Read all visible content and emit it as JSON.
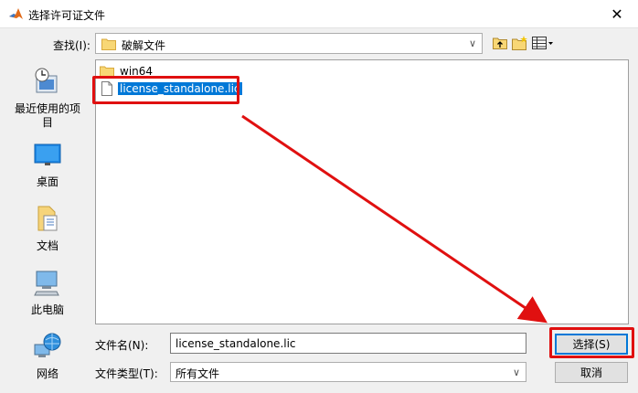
{
  "window": {
    "title": "选择许可证文件",
    "close_glyph": "✕",
    "app_icon": "matlab-icon"
  },
  "lookin": {
    "label": "查找(I):",
    "value": "破解文件"
  },
  "toolbar": {
    "icons": [
      "up-folder-icon",
      "new-folder-icon",
      "view-menu-icon"
    ]
  },
  "places": [
    {
      "label": "最近使用的项目",
      "icon": "recent-icon"
    },
    {
      "label": "桌面",
      "icon": "desktop-icon"
    },
    {
      "label": "文档",
      "icon": "documents-icon"
    },
    {
      "label": "此电脑",
      "icon": "computer-icon"
    },
    {
      "label": "网络",
      "icon": "network-icon"
    }
  ],
  "files": [
    {
      "name": "win64",
      "type": "folder",
      "selected": false
    },
    {
      "name": "license_standalone.lic",
      "type": "file",
      "selected": true
    }
  ],
  "filename": {
    "label": "文件名(N):",
    "value": "license_standalone.lic"
  },
  "filetype": {
    "label": "文件类型(T):",
    "value": "所有文件"
  },
  "buttons": {
    "select": "选择(S)",
    "cancel": "取消"
  },
  "colors": {
    "annotation": "#e01010",
    "selection": "#0078d7"
  }
}
